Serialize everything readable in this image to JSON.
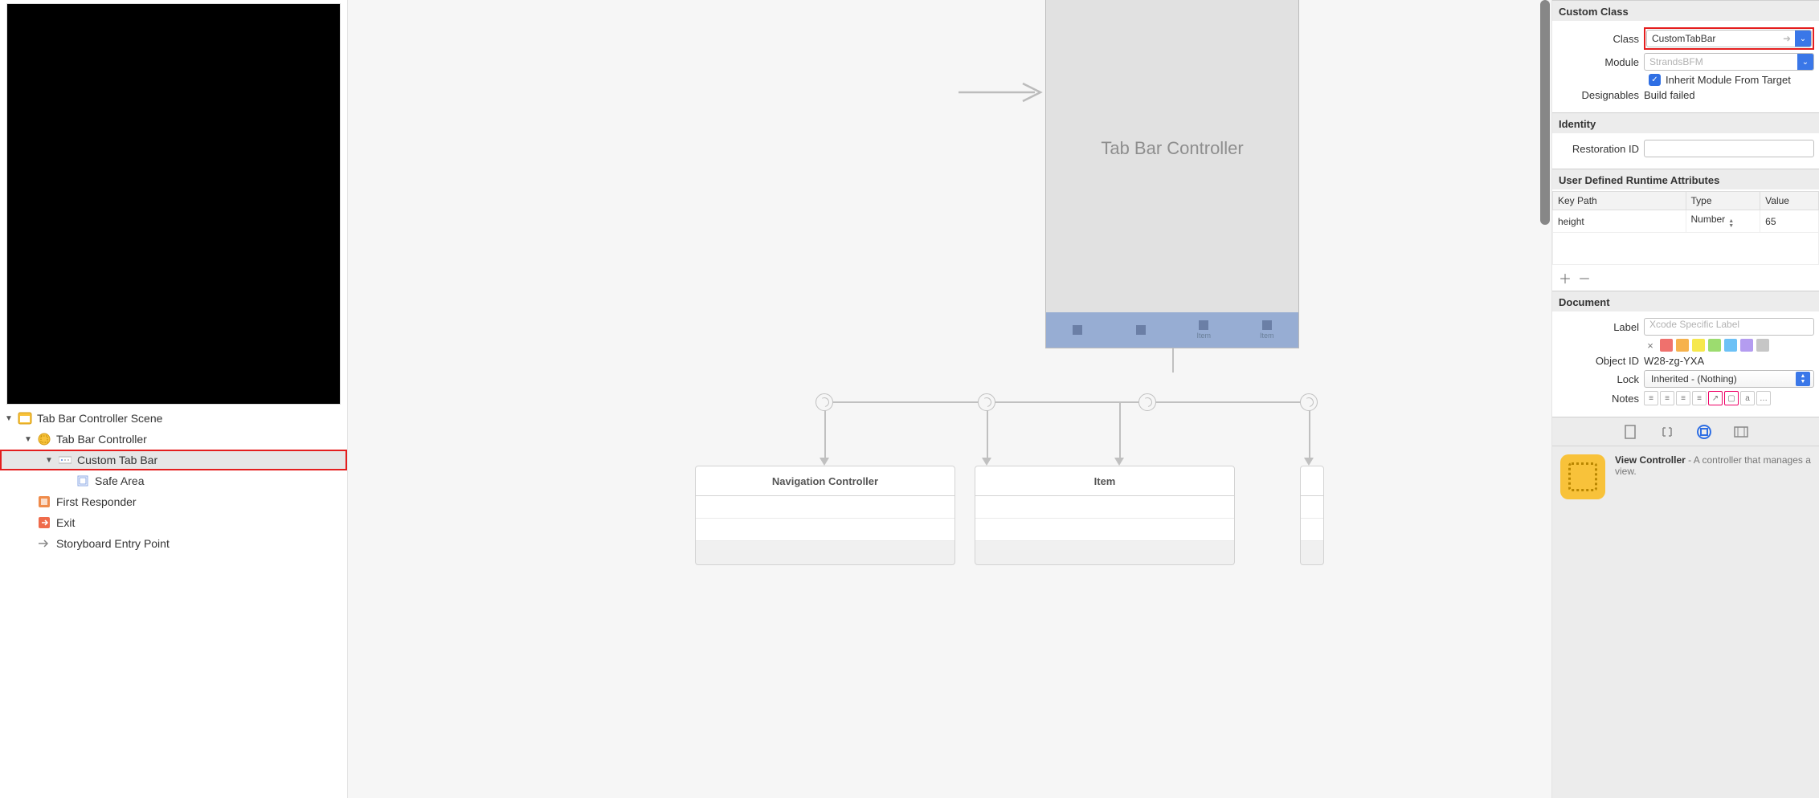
{
  "outline": {
    "scene": "Tab Bar Controller Scene",
    "tabBarController": "Tab Bar Controller",
    "customTabBar": "Custom Tab Bar",
    "safeArea": "Safe Area",
    "firstResponder": "First Responder",
    "exit": "Exit",
    "entryPoint": "Storyboard Entry Point"
  },
  "canvas": {
    "sceneTitle": "Tab Bar Controller",
    "tabs": {
      "item3": "Item",
      "item4": "Item"
    },
    "stubs": {
      "nav": "Navigation Controller",
      "item": "Item"
    }
  },
  "inspector": {
    "customClass": {
      "header": "Custom Class",
      "classLabel": "Class",
      "classValue": "CustomTabBar",
      "moduleLabel": "Module",
      "modulePlaceholder": "StrandsBFM",
      "inheritLabel": "Inherit Module From Target",
      "designablesLabel": "Designables",
      "designablesValue": "Build failed"
    },
    "identity": {
      "header": "Identity",
      "restorationLabel": "Restoration ID"
    },
    "runtime": {
      "header": "User Defined Runtime Attributes",
      "cols": {
        "keyPath": "Key Path",
        "type": "Type",
        "value": "Value"
      },
      "row": {
        "keyPath": "height",
        "type": "Number",
        "value": "65"
      }
    },
    "document": {
      "header": "Document",
      "labelLabel": "Label",
      "labelPlaceholder": "Xcode Specific Label",
      "objectIdLabel": "Object ID",
      "objectIdValue": "W28-zg-YXA",
      "lockLabel": "Lock",
      "lockValue": "Inherited - (Nothing)",
      "notesLabel": "Notes"
    },
    "library": {
      "title": "View Controller",
      "desc": " - A controller that manages a view."
    }
  },
  "colors": {
    "swatches": [
      "#ef716d",
      "#f6b24c",
      "#f6e84c",
      "#9cdc6f",
      "#6cc1f6",
      "#b49cf0",
      "#c6c6c6"
    ]
  }
}
